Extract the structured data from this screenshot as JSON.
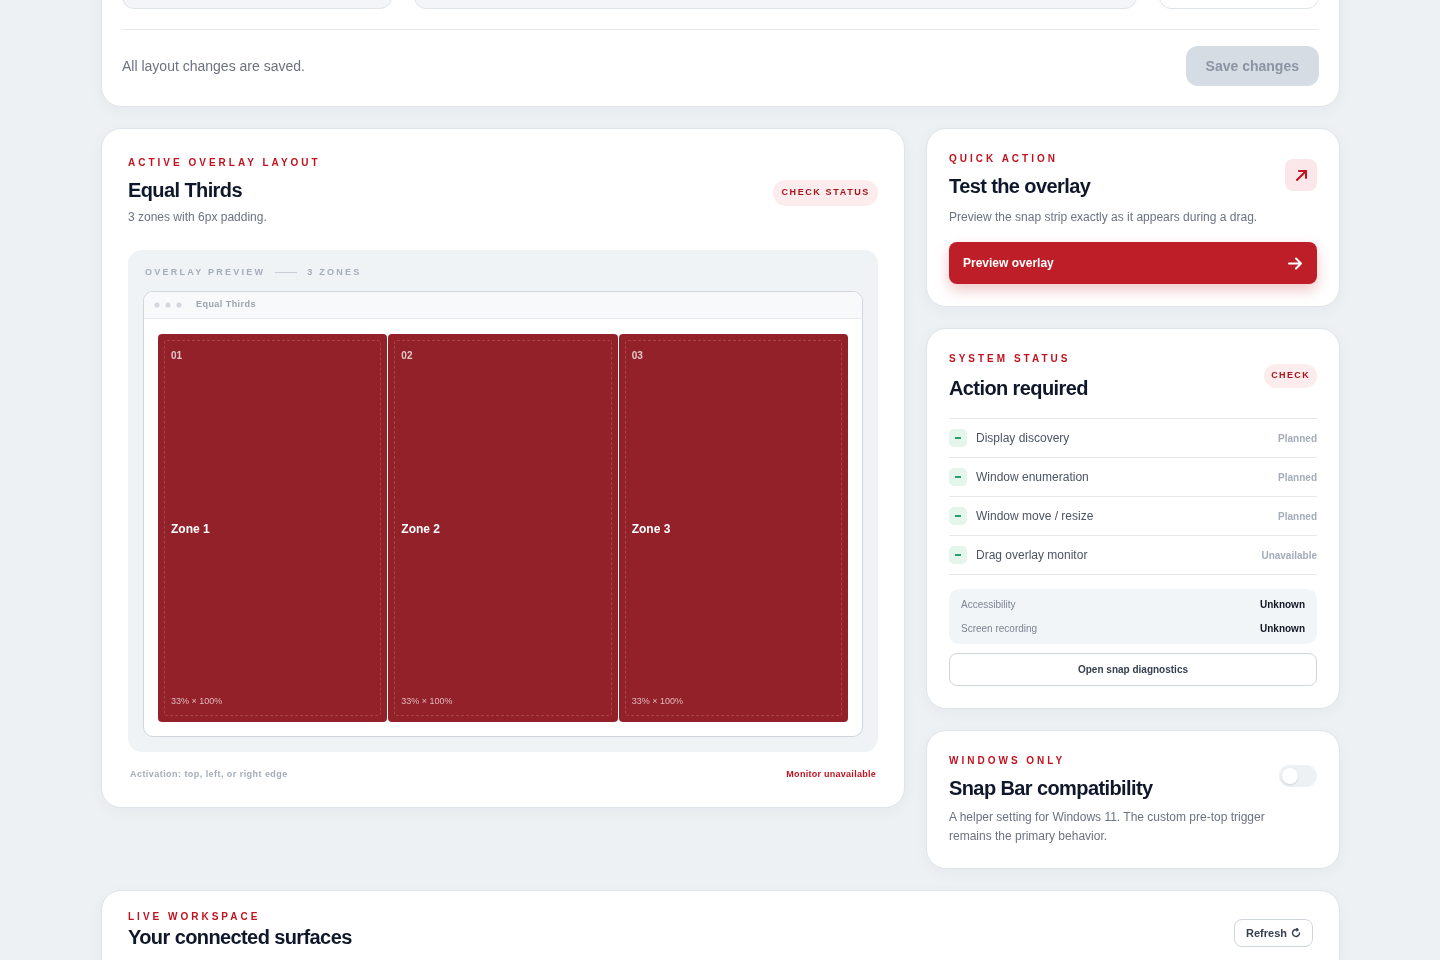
{
  "settings_card": {
    "fields": [
      {
        "kind": "field"
      },
      {
        "kind": "field"
      },
      {
        "kind": "field"
      }
    ],
    "note": "All layout changes are saved.",
    "save_button": {
      "label": "Save changes",
      "disabled": true
    }
  },
  "layout_card": {
    "eyebrow": "ACTIVE OVERLAY LAYOUT",
    "title": "Equal Thirds",
    "badge": "CHECK STATUS",
    "subtitle": "3 zones with 6px padding.",
    "preview": {
      "label": "OVERLAY PREVIEW",
      "count": "3 ZONES",
      "window_title": "Equal Thirds",
      "zones": [
        {
          "number": "01",
          "name": "Zone 1",
          "size": "33% × 100%"
        },
        {
          "number": "02",
          "name": "Zone 2",
          "size": "33% × 100%"
        },
        {
          "number": "03",
          "name": "Zone 3",
          "size": "33% × 100%"
        }
      ]
    },
    "activation": "Activation: top, left, or right edge",
    "monitor_status": "Monitor unavailable"
  },
  "quick_action": {
    "eyebrow": "QUICK ACTION",
    "title": "Test the overlay",
    "description": "Preview the snap strip exactly as it appears during a drag.",
    "button": "Preview overlay"
  },
  "system_status": {
    "eyebrow": "SYSTEM STATUS",
    "title": "Action required",
    "badge": "CHECK",
    "items": [
      {
        "label": "Display discovery",
        "status": "Planned"
      },
      {
        "label": "Window enumeration",
        "status": "Planned"
      },
      {
        "label": "Window move / resize",
        "status": "Planned"
      },
      {
        "label": "Drag overlay monitor",
        "status": "Unavailable"
      }
    ],
    "permissions": [
      {
        "label": "Accessibility",
        "value": "Unknown"
      },
      {
        "label": "Screen recording",
        "value": "Unknown"
      }
    ],
    "button": "Open snap diagnostics"
  },
  "snap_bar": {
    "eyebrow": "WINDOWS ONLY",
    "title": "Snap Bar compatibility",
    "on": false,
    "description": "A helper setting for Windows 11. The custom pre-top trigger remains the primary behavior."
  },
  "workspace": {
    "eyebrow": "LIVE WORKSPACE",
    "title": "Your connected surfaces",
    "button": "Refresh"
  }
}
